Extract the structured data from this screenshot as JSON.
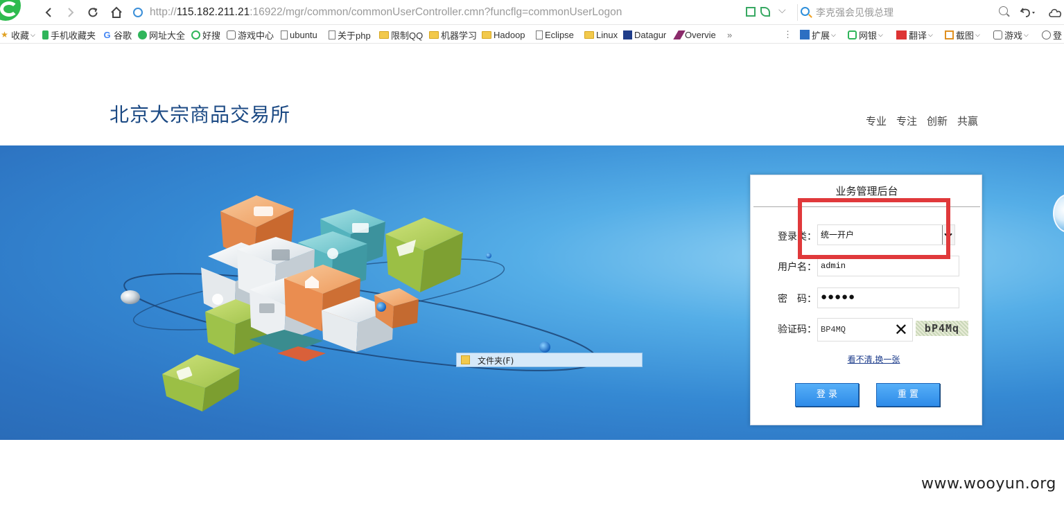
{
  "browser": {
    "url_prefix": "http://",
    "url_host": "115.182.211.21",
    "url_rest": ":16922/mgr/common/commonUserController.cmn?funcflg=commonUserLogon",
    "search_text": "李克强会见俄总理",
    "right_tools": [
      "扩展",
      "网银",
      "翻译",
      "截图",
      "游戏",
      "登"
    ]
  },
  "bookmarks": [
    {
      "label": "收藏",
      "icon": "star-icon"
    },
    {
      "label": "手机收藏夹",
      "icon": "phone-icon"
    },
    {
      "label": "谷歌",
      "icon": "google-icon"
    },
    {
      "label": "网址大全",
      "icon": "site-nav-icon"
    },
    {
      "label": "好搜",
      "icon": "haosou-icon"
    },
    {
      "label": "游戏中心",
      "icon": "game-icon"
    },
    {
      "label": "ubuntu",
      "icon": "page-icon"
    },
    {
      "label": "关于php",
      "icon": "page-icon"
    },
    {
      "label": "限制QQ",
      "icon": "folder-icon"
    },
    {
      "label": "机器学习",
      "icon": "folder-icon"
    },
    {
      "label": "Hadoop",
      "icon": "folder-icon"
    },
    {
      "label": "Eclipse",
      "icon": "page-icon"
    },
    {
      "label": "Linux",
      "icon": "folder-icon"
    },
    {
      "label": "Datagur",
      "icon": "chart-icon"
    },
    {
      "label": "Overvie",
      "icon": "feather-icon"
    }
  ],
  "bookmarks_more": "»",
  "site": {
    "title": "北京大宗商品交易所",
    "slogans": [
      "专业",
      "专注",
      "创新",
      "共赢"
    ]
  },
  "context_menu": {
    "folder_item": "文件夹(F)"
  },
  "login": {
    "title": "业务管理后台",
    "type_label": "登录类：",
    "type_value": "统一开户",
    "username_label": "用户名：",
    "username_value": "admin",
    "password_label": "密　码：",
    "password_value": "●●●●●",
    "captcha_label": "验证码：",
    "captcha_value": "BP4MQ",
    "captcha_image_text": "bP4Mq",
    "refresh_link": "看不清,换一张",
    "login_button": "登 录",
    "reset_button": "重 置"
  },
  "watermark": "www.wooyun.org",
  "colors": {
    "banner_light": "#8fd0f3",
    "banner_dark": "#2a6cb8",
    "button_blue": "#2e8be8",
    "highlight_red": "#e0393b",
    "title_blue": "#1c4a84"
  }
}
